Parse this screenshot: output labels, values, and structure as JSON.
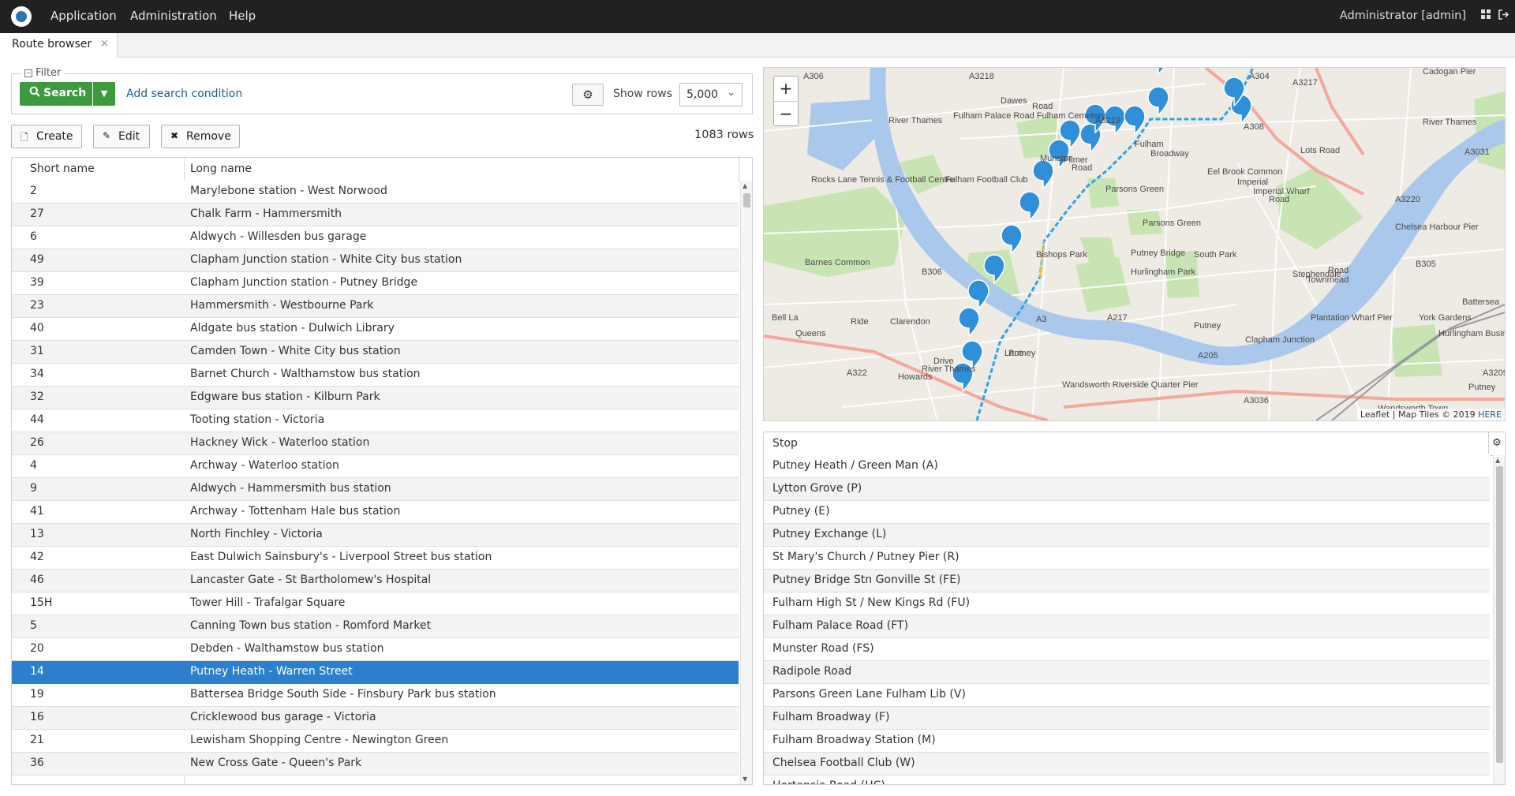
{
  "menu": {
    "items": [
      "Application",
      "Administration",
      "Help"
    ],
    "user": "Administrator [admin]"
  },
  "tabs": [
    {
      "label": "Route browser",
      "close": "×"
    }
  ],
  "filter": {
    "legend": "Filter",
    "search_label": "Search",
    "add_condition": "Add search condition",
    "show_rows_label": "Show rows",
    "show_rows_value": "5,000"
  },
  "toolbar": {
    "create": "Create",
    "edit": "Edit",
    "remove": "Remove",
    "rows_count": "1083 rows"
  },
  "routes": {
    "headers": [
      "Short name",
      "Long name"
    ],
    "rows": [
      [
        "2",
        "Marylebone station - West Norwood"
      ],
      [
        "27",
        "Chalk Farm - Hammersmith"
      ],
      [
        "6",
        "Aldwych - Willesden bus garage"
      ],
      [
        "49",
        "Clapham Junction station - White City bus station"
      ],
      [
        "39",
        "Clapham Junction station - Putney Bridge"
      ],
      [
        "23",
        "Hammersmith - Westbourne Park"
      ],
      [
        "40",
        "Aldgate bus station - Dulwich Library"
      ],
      [
        "31",
        "Camden Town - White City bus station"
      ],
      [
        "34",
        "Barnet Church - Walthamstow bus station"
      ],
      [
        "32",
        "Edgware bus station - Kilburn Park"
      ],
      [
        "44",
        "Tooting station - Victoria"
      ],
      [
        "26",
        "Hackney Wick - Waterloo station"
      ],
      [
        "4",
        "Archway - Waterloo station"
      ],
      [
        "9",
        "Aldwych - Hammersmith bus station"
      ],
      [
        "41",
        "Archway - Tottenham Hale bus station"
      ],
      [
        "13",
        "North Finchley - Victoria"
      ],
      [
        "42",
        "East Dulwich Sainsbury's - Liverpool Street bus station"
      ],
      [
        "46",
        "Lancaster Gate - St Bartholomew's Hospital"
      ],
      [
        "15H",
        "Tower Hill - Trafalgar Square"
      ],
      [
        "5",
        "Canning Town bus station - Romford Market"
      ],
      [
        "20",
        "Debden - Walthamstow bus station"
      ],
      [
        "14",
        "Putney Heath - Warren Street"
      ],
      [
        "19",
        "Battersea Bridge South Side - Finsbury Park bus station"
      ],
      [
        "16",
        "Cricklewood bus garage - Victoria"
      ],
      [
        "21",
        "Lewisham Shopping Centre - Newington Green"
      ],
      [
        "36",
        "New Cross Gate - Queen's Park"
      ]
    ],
    "selected_index": 21
  },
  "map": {
    "zoom_in": "+",
    "zoom_out": "−",
    "attribution": "Leaflet | Map Tiles © 2019",
    "attribution_link": "HERE",
    "labels": [
      "A306",
      "A3218",
      "A304",
      "A3217",
      "Cadogan Pier",
      "Dawes",
      "Road",
      "River Thames",
      "Fulham Palace Road Fulham Cemetery",
      "A3219",
      "Fulham",
      "Broadway",
      "A308",
      "Lots Road",
      "River Thames",
      "A3031",
      "Munster",
      "Filmer",
      "Road",
      "Eel Brook Common",
      "Imperial Wharf",
      "Imperial",
      "Road",
      "Rocks Lane Tennis & Football Centre",
      "Fulham Football Club",
      "Parsons Green",
      "Parsons Green",
      "A3220",
      "Chelsea Harbour Pier",
      "Barnes Common",
      "Bishops Park",
      "Putney Bridge",
      "South Park",
      "Stephendale",
      "Townmead",
      "Road",
      "B305",
      "A3",
      "B306",
      "Queens",
      "Ride",
      "Putney",
      "Hurlingham Park",
      "York Gardens",
      "Battersea",
      "A217",
      "Plantation Wharf Pier",
      "Clarendon",
      "Drive",
      "Putney",
      "Hurlingham Business Park",
      "Clapham Junction",
      "River Thames",
      "A205",
      "Wandsworth Riverside Quarter Pier",
      "A3209",
      "A322",
      "Howards",
      "Lane",
      "Putney",
      "A3036",
      "Wandsworth Town",
      "Bell La"
    ]
  },
  "stops": {
    "header": "Stop",
    "rows": [
      "Putney Heath / Green Man (A)",
      "Lytton Grove (P)",
      "Putney (E)",
      "Putney Exchange (L)",
      "St Mary's Church / Putney Pier (R)",
      "Putney Bridge Stn Gonville St (FE)",
      "Fulham High St / New Kings Rd (FU)",
      "Fulham Palace Road (FT)",
      "Munster Road (FS)",
      "Radipole Road",
      "Parsons Green Lane Fulham Lib (V)",
      "Fulham Broadway (F)",
      "Fulham Broadway Station (M)",
      "Chelsea Football Club (W)",
      "Hortensia Road (HC)"
    ]
  },
  "colors": {
    "topbar": "#212121",
    "search_green": "#3d9a3d",
    "selection_blue": "#2b7fcc",
    "link_blue": "#1e5a92",
    "river": "#a9c8ec",
    "park": "#c9e4b3",
    "route": "#2fa3e6"
  }
}
